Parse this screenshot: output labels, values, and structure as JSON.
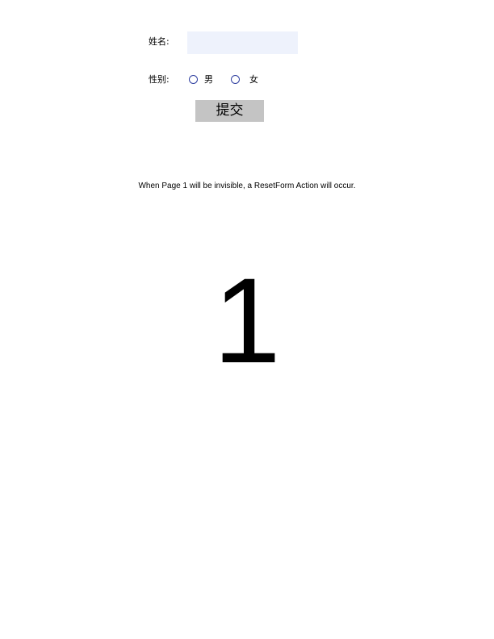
{
  "form": {
    "name_label": "姓名:",
    "name_value": "",
    "gender_label": "性别:",
    "gender_options": [
      "男",
      "女"
    ],
    "submit_label": "提交"
  },
  "note": "When Page 1 will be invisible, a ResetForm Action will occur.",
  "page_number": "1",
  "colors": {
    "field_background": "#eef2fc",
    "button_background": "#c4c4c4",
    "radio_border": "#2f3fa0"
  }
}
